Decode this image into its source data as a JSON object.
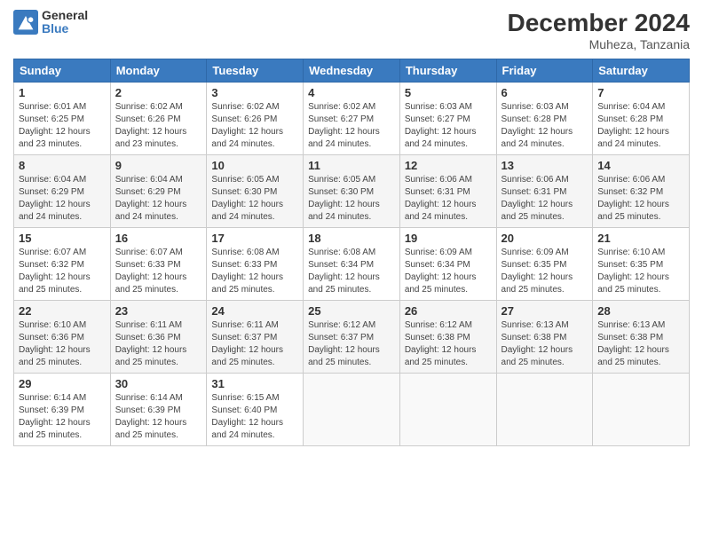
{
  "logo": {
    "general": "General",
    "blue": "Blue"
  },
  "header": {
    "month": "December 2024",
    "location": "Muheza, Tanzania"
  },
  "weekdays": [
    "Sunday",
    "Monday",
    "Tuesday",
    "Wednesday",
    "Thursday",
    "Friday",
    "Saturday"
  ],
  "weeks": [
    [
      {
        "day": "1",
        "sunrise": "6:01 AM",
        "sunset": "6:25 PM",
        "daylight": "12 hours and 23 minutes."
      },
      {
        "day": "2",
        "sunrise": "6:02 AM",
        "sunset": "6:26 PM",
        "daylight": "12 hours and 23 minutes."
      },
      {
        "day": "3",
        "sunrise": "6:02 AM",
        "sunset": "6:26 PM",
        "daylight": "12 hours and 24 minutes."
      },
      {
        "day": "4",
        "sunrise": "6:02 AM",
        "sunset": "6:27 PM",
        "daylight": "12 hours and 24 minutes."
      },
      {
        "day": "5",
        "sunrise": "6:03 AM",
        "sunset": "6:27 PM",
        "daylight": "12 hours and 24 minutes."
      },
      {
        "day": "6",
        "sunrise": "6:03 AM",
        "sunset": "6:28 PM",
        "daylight": "12 hours and 24 minutes."
      },
      {
        "day": "7",
        "sunrise": "6:04 AM",
        "sunset": "6:28 PM",
        "daylight": "12 hours and 24 minutes."
      }
    ],
    [
      {
        "day": "8",
        "sunrise": "6:04 AM",
        "sunset": "6:29 PM",
        "daylight": "12 hours and 24 minutes."
      },
      {
        "day": "9",
        "sunrise": "6:04 AM",
        "sunset": "6:29 PM",
        "daylight": "12 hours and 24 minutes."
      },
      {
        "day": "10",
        "sunrise": "6:05 AM",
        "sunset": "6:30 PM",
        "daylight": "12 hours and 24 minutes."
      },
      {
        "day": "11",
        "sunrise": "6:05 AM",
        "sunset": "6:30 PM",
        "daylight": "12 hours and 24 minutes."
      },
      {
        "day": "12",
        "sunrise": "6:06 AM",
        "sunset": "6:31 PM",
        "daylight": "12 hours and 24 minutes."
      },
      {
        "day": "13",
        "sunrise": "6:06 AM",
        "sunset": "6:31 PM",
        "daylight": "12 hours and 25 minutes."
      },
      {
        "day": "14",
        "sunrise": "6:06 AM",
        "sunset": "6:32 PM",
        "daylight": "12 hours and 25 minutes."
      }
    ],
    [
      {
        "day": "15",
        "sunrise": "6:07 AM",
        "sunset": "6:32 PM",
        "daylight": "12 hours and 25 minutes."
      },
      {
        "day": "16",
        "sunrise": "6:07 AM",
        "sunset": "6:33 PM",
        "daylight": "12 hours and 25 minutes."
      },
      {
        "day": "17",
        "sunrise": "6:08 AM",
        "sunset": "6:33 PM",
        "daylight": "12 hours and 25 minutes."
      },
      {
        "day": "18",
        "sunrise": "6:08 AM",
        "sunset": "6:34 PM",
        "daylight": "12 hours and 25 minutes."
      },
      {
        "day": "19",
        "sunrise": "6:09 AM",
        "sunset": "6:34 PM",
        "daylight": "12 hours and 25 minutes."
      },
      {
        "day": "20",
        "sunrise": "6:09 AM",
        "sunset": "6:35 PM",
        "daylight": "12 hours and 25 minutes."
      },
      {
        "day": "21",
        "sunrise": "6:10 AM",
        "sunset": "6:35 PM",
        "daylight": "12 hours and 25 minutes."
      }
    ],
    [
      {
        "day": "22",
        "sunrise": "6:10 AM",
        "sunset": "6:36 PM",
        "daylight": "12 hours and 25 minutes."
      },
      {
        "day": "23",
        "sunrise": "6:11 AM",
        "sunset": "6:36 PM",
        "daylight": "12 hours and 25 minutes."
      },
      {
        "day": "24",
        "sunrise": "6:11 AM",
        "sunset": "6:37 PM",
        "daylight": "12 hours and 25 minutes."
      },
      {
        "day": "25",
        "sunrise": "6:12 AM",
        "sunset": "6:37 PM",
        "daylight": "12 hours and 25 minutes."
      },
      {
        "day": "26",
        "sunrise": "6:12 AM",
        "sunset": "6:38 PM",
        "daylight": "12 hours and 25 minutes."
      },
      {
        "day": "27",
        "sunrise": "6:13 AM",
        "sunset": "6:38 PM",
        "daylight": "12 hours and 25 minutes."
      },
      {
        "day": "28",
        "sunrise": "6:13 AM",
        "sunset": "6:38 PM",
        "daylight": "12 hours and 25 minutes."
      }
    ],
    [
      {
        "day": "29",
        "sunrise": "6:14 AM",
        "sunset": "6:39 PM",
        "daylight": "12 hours and 25 minutes."
      },
      {
        "day": "30",
        "sunrise": "6:14 AM",
        "sunset": "6:39 PM",
        "daylight": "12 hours and 25 minutes."
      },
      {
        "day": "31",
        "sunrise": "6:15 AM",
        "sunset": "6:40 PM",
        "daylight": "12 hours and 24 minutes."
      },
      null,
      null,
      null,
      null
    ]
  ]
}
